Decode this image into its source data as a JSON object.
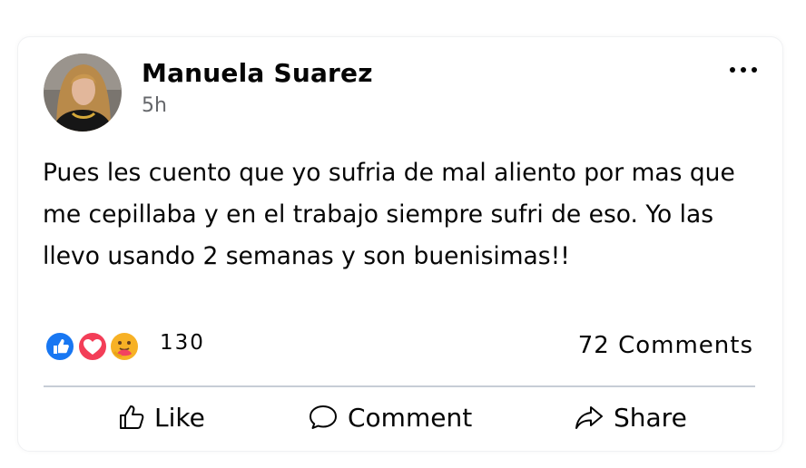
{
  "post": {
    "author": "Manuela Suarez",
    "time": "5h",
    "text": "Pues les cuento que yo sufria de mal aliento por mas que me cepillaba y en el trabajo siempre sufri de eso. Yo las llevo usando 2 semanas y son buenisimas!!",
    "reactions": {
      "icons": [
        "like-icon",
        "love-icon",
        "care-icon"
      ],
      "count": "130"
    },
    "comments": "72 Comments"
  },
  "actions": {
    "like": "Like",
    "comment": "Comment",
    "share": "Share"
  },
  "colors": {
    "like_blue": "#1877f2",
    "love_red": "#f33e58",
    "care_yellow": "#f7b125",
    "secondary_text": "#65676b",
    "divider": "#c7cdd6"
  }
}
